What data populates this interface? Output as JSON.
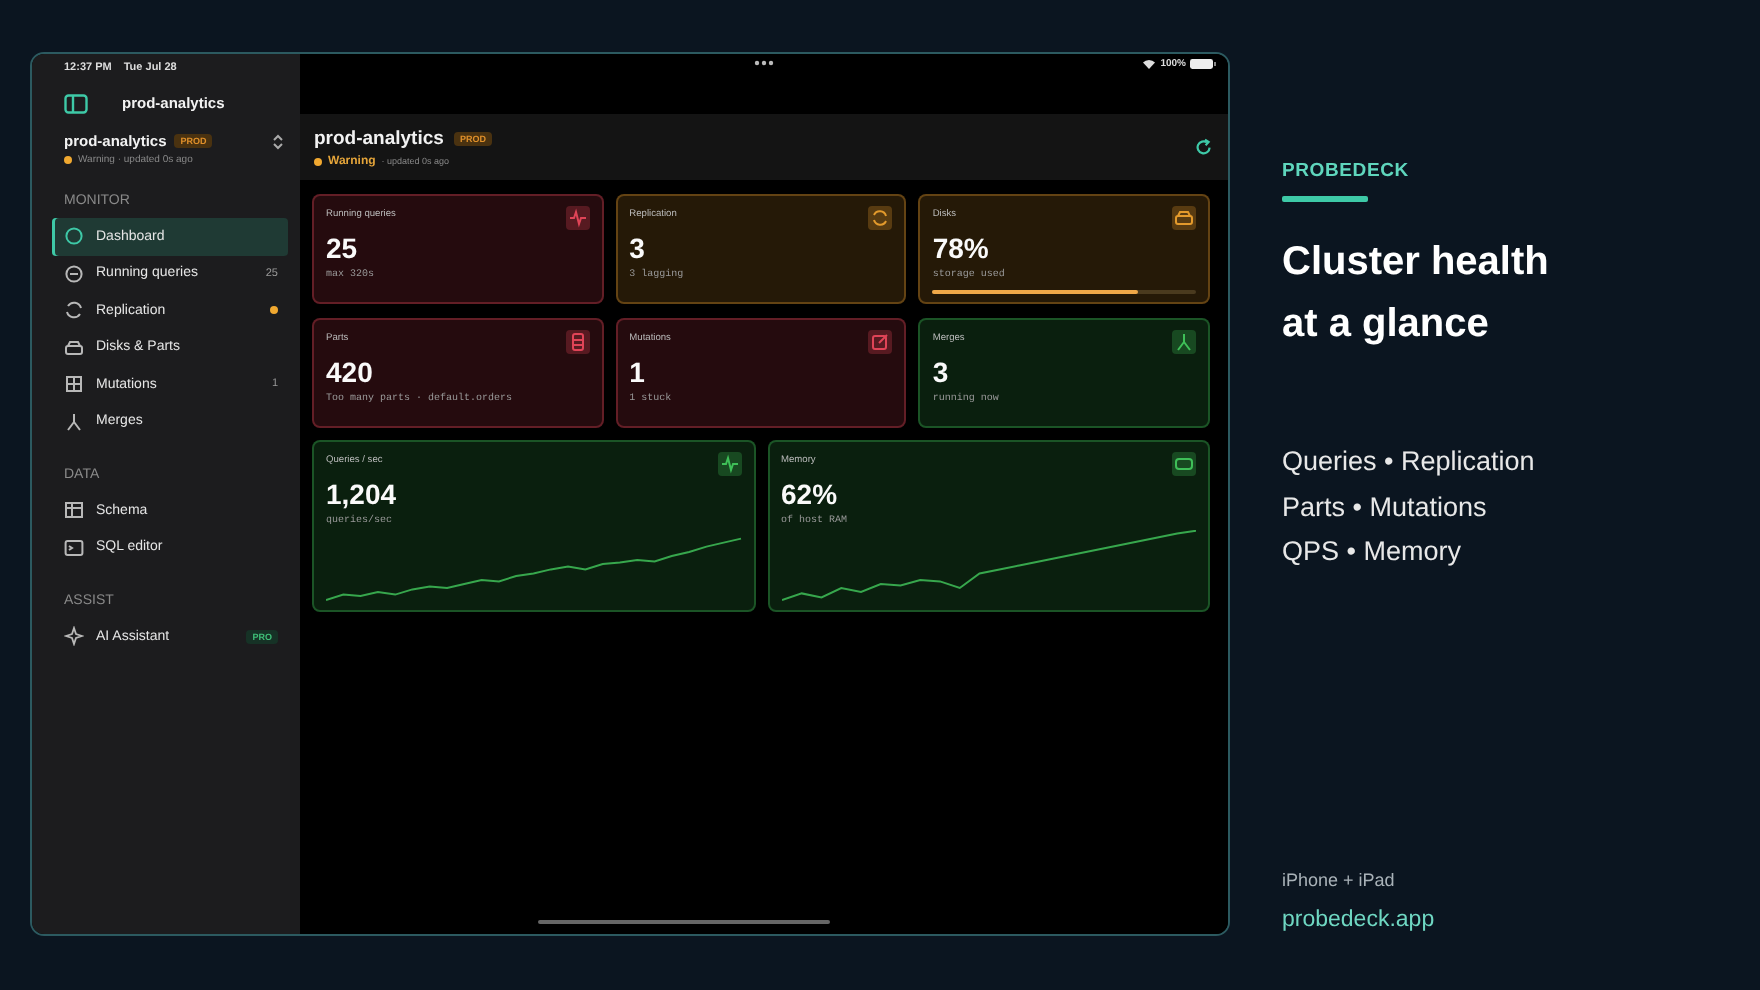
{
  "status_bar": {
    "time": "12:37 PM",
    "date": "Tue Jul 28",
    "battery": "100%"
  },
  "sidebar": {
    "title": "prod-analytics",
    "cluster": {
      "name": "prod-analytics",
      "env": "PROD",
      "status": "Warning · updated 0s ago"
    },
    "sections": [
      {
        "heading": "MONITOR",
        "items": [
          {
            "label": "Dashboard",
            "selected": true,
            "alert": false
          },
          {
            "label": "Running queries",
            "selected": false,
            "alert": false,
            "count": "25"
          },
          {
            "label": "Replication",
            "selected": false,
            "alert": true
          },
          {
            "label": "Disks & Parts",
            "selected": false,
            "alert": false
          },
          {
            "label": "Mutations",
            "selected": false,
            "alert": false,
            "count": "1"
          },
          {
            "label": "Merges",
            "selected": false,
            "alert": false
          }
        ]
      },
      {
        "heading": "DATA",
        "items": [
          {
            "label": "Schema",
            "selected": false,
            "alert": false
          },
          {
            "label": "SQL editor",
            "selected": false,
            "alert": false
          }
        ]
      },
      {
        "heading": "ASSIST",
        "items": [
          {
            "label": "AI Assistant",
            "selected": false,
            "alert": false,
            "tag": "PRO"
          }
        ]
      }
    ]
  },
  "header": {
    "title": "prod-analytics",
    "env": "PROD",
    "status": "Warning",
    "updated": "· updated 0s ago"
  },
  "cards": [
    {
      "label": "Running queries",
      "value": "25",
      "caption": "max 320s",
      "color": "#e04457"
    },
    {
      "label": "Replication",
      "value": "3",
      "caption": "3 lagging",
      "color": "#e39a2c"
    },
    {
      "label": "Disks",
      "value": "78%",
      "caption": "storage used",
      "color": "#e39a2c",
      "level": 0.78
    },
    {
      "label": "Parts",
      "value": "420",
      "caption": "Too many parts · default.orders",
      "color": "#e04457"
    },
    {
      "label": "Mutations",
      "value": "1",
      "caption": "1 stuck",
      "color": "#e04457"
    },
    {
      "label": "Merges",
      "value": "3",
      "caption": "running now",
      "color": "#3fbf58"
    }
  ],
  "trend_cards": [
    {
      "label": "Queries / sec",
      "value": "1,204",
      "caption": "queries/sec",
      "color": "#3fbf58"
    },
    {
      "label": "Memory",
      "value": "62%",
      "caption": "of host RAM",
      "color": "#3fbf58"
    }
  ],
  "promo": {
    "brand": "PROBEDECK",
    "headline": [
      "Cluster health",
      "at a glance"
    ],
    "features": [
      "Queries • Replication",
      "Parts • Mutations",
      "QPS • Memory"
    ],
    "platforms": "iPhone + iPad",
    "url": "probedeck.app"
  }
}
